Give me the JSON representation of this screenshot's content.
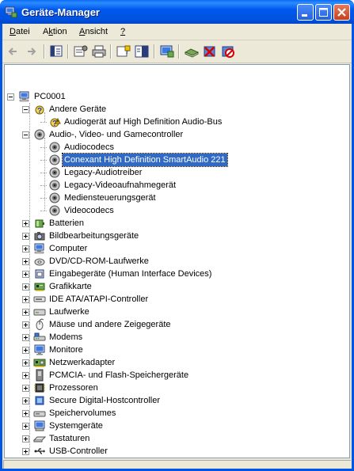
{
  "window": {
    "title": "Geräte-Manager"
  },
  "menu": [
    {
      "label": "Datei",
      "accel": "D"
    },
    {
      "label": "Aktion",
      "accel": "k"
    },
    {
      "label": "Ansicht",
      "accel": "A"
    },
    {
      "label": "?",
      "accel": "?"
    }
  ],
  "toolbar": [
    "back-icon",
    "forward-icon",
    "console-tree-icon",
    "properties-icon",
    "print-icon",
    "help-icon",
    "show-hide-icon",
    "scan-hardware-icon",
    "update-driver-icon",
    "uninstall-icon",
    "disable-icon"
  ],
  "tree": {
    "root": "PC0001",
    "expanded": [
      {
        "label": "Andere Geräte",
        "icon": "unknown-device-icon",
        "children": [
          {
            "label": "Audiogerät auf High Definition Audio-Bus",
            "icon": "warning-device-icon"
          }
        ]
      },
      {
        "label": "Audio-, Video- und Gamecontroller",
        "icon": "sound-icon",
        "children": [
          {
            "label": "Audiocodecs",
            "icon": "sound-icon"
          },
          {
            "label": "Conexant High Definition SmartAudio 221",
            "icon": "sound-icon",
            "selected": true
          },
          {
            "label": "Legacy-Audiotreiber",
            "icon": "sound-icon"
          },
          {
            "label": "Legacy-Videoaufnahmegerät",
            "icon": "sound-icon"
          },
          {
            "label": "Mediensteuerungsgerät",
            "icon": "sound-icon"
          },
          {
            "label": "Videocodecs",
            "icon": "sound-icon"
          }
        ]
      }
    ],
    "collapsed": [
      {
        "label": "Batterien",
        "icon": "battery-icon"
      },
      {
        "label": "Bildbearbeitungsgeräte",
        "icon": "camera-icon"
      },
      {
        "label": "Computer",
        "icon": "computer-icon"
      },
      {
        "label": "DVD/CD-ROM-Laufwerke",
        "icon": "cdrom-icon"
      },
      {
        "label": "Eingabegeräte (Human Interface Devices)",
        "icon": "hid-icon"
      },
      {
        "label": "Grafikkarte",
        "icon": "display-adapter-icon"
      },
      {
        "label": "IDE ATA/ATAPI-Controller",
        "icon": "ide-controller-icon"
      },
      {
        "label": "Laufwerke",
        "icon": "disk-drive-icon"
      },
      {
        "label": "Mäuse und andere Zeigegeräte",
        "icon": "mouse-icon"
      },
      {
        "label": "Modems",
        "icon": "modem-icon"
      },
      {
        "label": "Monitore",
        "icon": "monitor-icon"
      },
      {
        "label": "Netzwerkadapter",
        "icon": "network-adapter-icon"
      },
      {
        "label": "PCMCIA- und Flash-Speichergeräte",
        "icon": "pcmcia-icon"
      },
      {
        "label": "Prozessoren",
        "icon": "processor-icon"
      },
      {
        "label": "Secure Digital-Hostcontroller",
        "icon": "sd-host-icon"
      },
      {
        "label": "Speichervolumes",
        "icon": "storage-volume-icon"
      },
      {
        "label": "Systemgeräte",
        "icon": "system-device-icon"
      },
      {
        "label": "Tastaturen",
        "icon": "keyboard-icon"
      },
      {
        "label": "USB-Controller",
        "icon": "usb-icon"
      }
    ]
  },
  "colors": {
    "titlebar": "#0054e3",
    "selection": "#316ac5",
    "face": "#ece9d8"
  }
}
